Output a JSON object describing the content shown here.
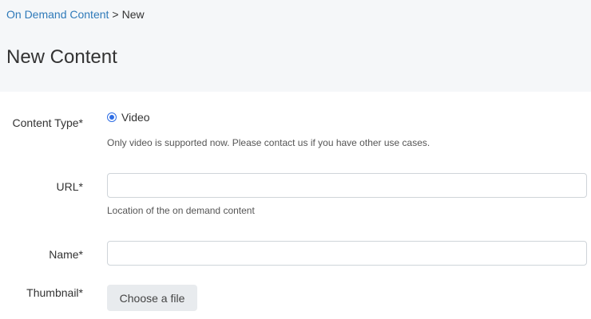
{
  "breadcrumb": {
    "parent": "On Demand Content",
    "separator": ">",
    "current": "New"
  },
  "page": {
    "title": "New Content"
  },
  "form": {
    "content_type": {
      "label": "Content Type*",
      "option_label": "Video",
      "selected": true,
      "help": "Only video is supported now. Please contact us if you have other use cases."
    },
    "url": {
      "label": "URL*",
      "value": "",
      "placeholder": "",
      "help": "Location of the on demand content"
    },
    "name": {
      "label": "Name*",
      "value": "",
      "placeholder": ""
    },
    "thumbnail": {
      "label": "Thumbnail*",
      "button_label": "Choose a file"
    }
  },
  "colors": {
    "link": "#2f7ab9",
    "radio_accent": "#2f6ee5",
    "header_bg": "#f5f7f9"
  }
}
